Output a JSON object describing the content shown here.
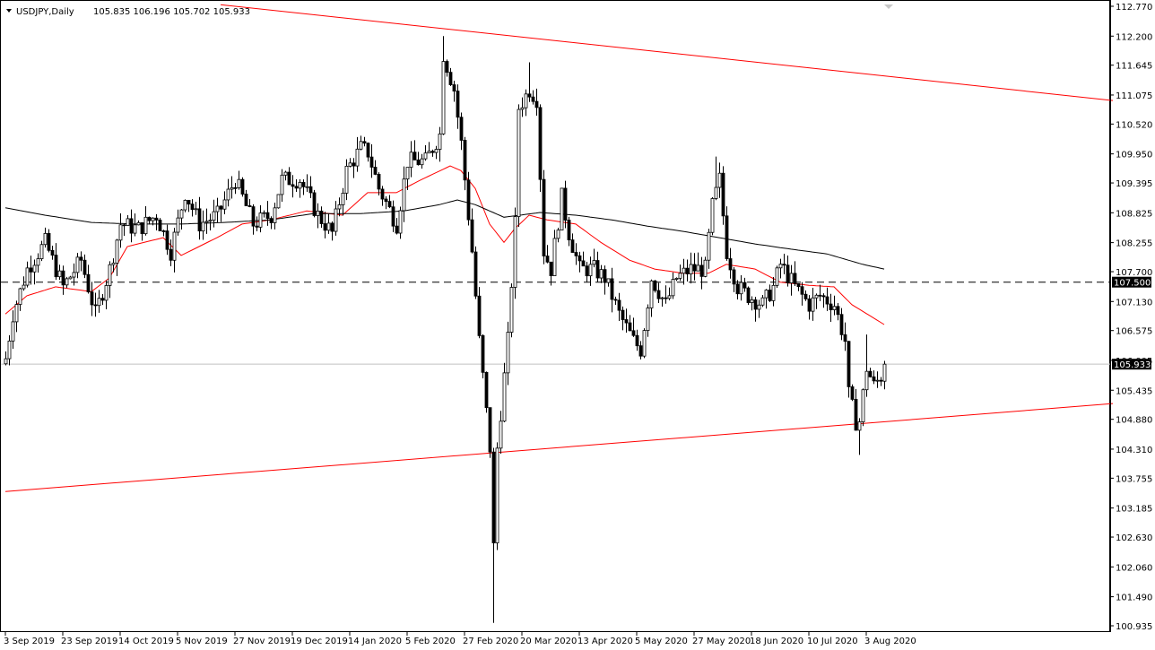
{
  "header": {
    "symbol": "USDJPY,Daily",
    "ohlc": "105.835 106.196 105.702 105.933"
  },
  "colors": {
    "bull_fill": "#ffffff",
    "bear_fill": "#000000",
    "ma_fast": "#ff0000",
    "ma_slow": "#000000",
    "trendline": "#ff0000",
    "level_line": "#000000",
    "price_line": "#c0c0c0"
  },
  "chart_data": {
    "type": "candlestick",
    "title": "USDJPY,Daily",
    "ylim": [
      100.935,
      112.77
    ],
    "y_ticks": [
      "112.770",
      "112.200",
      "111.645",
      "111.075",
      "110.520",
      "109.950",
      "109.395",
      "108.825",
      "108.255",
      "107.700",
      "107.130",
      "106.575",
      "106.005",
      "105.435",
      "104.880",
      "104.310",
      "103.755",
      "103.185",
      "102.630",
      "102.060",
      "101.490",
      "100.935"
    ],
    "x_ticks": [
      {
        "bar": 0,
        "label": "3 Sep 2019"
      },
      {
        "bar": 16,
        "label": "23 Sep 2019"
      },
      {
        "bar": 32,
        "label": "14 Oct 2019"
      },
      {
        "bar": 48,
        "label": "5 Nov 2019"
      },
      {
        "bar": 64,
        "label": "27 Nov 2019"
      },
      {
        "bar": 80,
        "label": "19 Dec 2019"
      },
      {
        "bar": 96,
        "label": "14 Jan 2020"
      },
      {
        "bar": 112,
        "label": "5 Feb 2020"
      },
      {
        "bar": 128,
        "label": "27 Feb 2020"
      },
      {
        "bar": 144,
        "label": "20 Mar 2020"
      },
      {
        "bar": 160,
        "label": "13 Apr 2020"
      },
      {
        "bar": 176,
        "label": "5 May 2020"
      },
      {
        "bar": 192,
        "label": "27 May 2020"
      },
      {
        "bar": 208,
        "label": "18 Jun 2020"
      },
      {
        "bar": 224,
        "label": "10 Jul 2020"
      },
      {
        "bar": 240,
        "label": "3 Aug 2020"
      }
    ],
    "bar_count": 246,
    "close_keypoints": [
      [
        0,
        106.04
      ],
      [
        2,
        106.89
      ],
      [
        6,
        107.75
      ],
      [
        11,
        108.26
      ],
      [
        16,
        107.41
      ],
      [
        21,
        107.92
      ],
      [
        25,
        106.89
      ],
      [
        29,
        107.75
      ],
      [
        32,
        108.61
      ],
      [
        37,
        108.52
      ],
      [
        42,
        108.78
      ],
      [
        46,
        108.09
      ],
      [
        50,
        109.21
      ],
      [
        54,
        108.61
      ],
      [
        59,
        108.78
      ],
      [
        64,
        109.46
      ],
      [
        69,
        108.61
      ],
      [
        74,
        108.78
      ],
      [
        77,
        109.46
      ],
      [
        82,
        109.46
      ],
      [
        87,
        108.78
      ],
      [
        91,
        108.44
      ],
      [
        95,
        109.63
      ],
      [
        99,
        110.06
      ],
      [
        101,
        109.98
      ],
      [
        104,
        109.29
      ],
      [
        109,
        108.61
      ],
      [
        112,
        109.81
      ],
      [
        117,
        109.81
      ],
      [
        121,
        110.32
      ],
      [
        122,
        111.86
      ],
      [
        125,
        111.18
      ],
      [
        127,
        110.15
      ],
      [
        130,
        108.09
      ],
      [
        132,
        106.38
      ],
      [
        135,
        104.33
      ],
      [
        136,
        102.44
      ],
      [
        137,
        104.33
      ],
      [
        140,
        106.38
      ],
      [
        142,
        108.61
      ],
      [
        143,
        110.83
      ],
      [
        146,
        111.18
      ],
      [
        148,
        111.01
      ],
      [
        150,
        108.09
      ],
      [
        152,
        107.75
      ],
      [
        155,
        109.12
      ],
      [
        157,
        108.44
      ],
      [
        160,
        107.75
      ],
      [
        164,
        107.75
      ],
      [
        167,
        107.58
      ],
      [
        171,
        106.89
      ],
      [
        175,
        106.38
      ],
      [
        177,
        106.21
      ],
      [
        180,
        107.58
      ],
      [
        184,
        107.07
      ],
      [
        187,
        107.58
      ],
      [
        191,
        107.75
      ],
      [
        195,
        107.75
      ],
      [
        197,
        108.95
      ],
      [
        199,
        109.46
      ],
      [
        201,
        108.09
      ],
      [
        204,
        107.41
      ],
      [
        207,
        107.24
      ],
      [
        211,
        107.07
      ],
      [
        214,
        107.41
      ],
      [
        216,
        107.84
      ],
      [
        220,
        107.41
      ],
      [
        224,
        107.07
      ],
      [
        227,
        107.24
      ],
      [
        231,
        107.07
      ],
      [
        234,
        106.38
      ],
      [
        235,
        105.35
      ],
      [
        237,
        104.84
      ],
      [
        238,
        104.84
      ],
      [
        240,
        105.87
      ],
      [
        242,
        105.52
      ],
      [
        244,
        105.7
      ],
      [
        245,
        105.933
      ]
    ],
    "wick_extremes": [
      {
        "bar": 122,
        "high": 112.2
      },
      {
        "bar": 136,
        "low": 100.99
      },
      {
        "bar": 146,
        "high": 111.7
      },
      {
        "bar": 198,
        "high": 109.9
      },
      {
        "bar": 238,
        "low": 104.2
      },
      {
        "bar": 240,
        "high": 106.5
      }
    ],
    "series": [
      {
        "name": "MA fast (red)",
        "keypoints": [
          [
            0,
            106.89
          ],
          [
            6,
            107.24
          ],
          [
            14,
            107.41
          ],
          [
            24,
            107.32
          ],
          [
            29,
            107.58
          ],
          [
            34,
            108.18
          ],
          [
            44,
            108.35
          ],
          [
            49,
            108.01
          ],
          [
            59,
            108.35
          ],
          [
            66,
            108.61
          ],
          [
            74,
            108.69
          ],
          [
            84,
            108.86
          ],
          [
            94,
            108.78
          ],
          [
            101,
            109.21
          ],
          [
            109,
            109.21
          ],
          [
            116,
            109.46
          ],
          [
            124,
            109.72
          ],
          [
            127,
            109.63
          ],
          [
            131,
            109.29
          ],
          [
            135,
            108.61
          ],
          [
            139,
            108.26
          ],
          [
            142,
            108.52
          ],
          [
            146,
            108.78
          ],
          [
            151,
            108.69
          ],
          [
            159,
            108.61
          ],
          [
            166,
            108.26
          ],
          [
            174,
            107.92
          ],
          [
            181,
            107.75
          ],
          [
            189,
            107.67
          ],
          [
            196,
            107.67
          ],
          [
            201,
            107.84
          ],
          [
            209,
            107.75
          ],
          [
            216,
            107.5
          ],
          [
            224,
            107.44
          ],
          [
            231,
            107.41
          ],
          [
            236,
            107.07
          ],
          [
            245,
            106.69
          ]
        ]
      },
      {
        "name": "MA slow (black)",
        "keypoints": [
          [
            0,
            108.92
          ],
          [
            11,
            108.78
          ],
          [
            24,
            108.64
          ],
          [
            36,
            108.61
          ],
          [
            49,
            108.61
          ],
          [
            61,
            108.64
          ],
          [
            74,
            108.69
          ],
          [
            86,
            108.81
          ],
          [
            99,
            108.81
          ],
          [
            111,
            108.86
          ],
          [
            121,
            108.98
          ],
          [
            126,
            109.07
          ],
          [
            131,
            108.98
          ],
          [
            139,
            108.74
          ],
          [
            149,
            108.83
          ],
          [
            159,
            108.78
          ],
          [
            169,
            108.69
          ],
          [
            179,
            108.57
          ],
          [
            189,
            108.47
          ],
          [
            199,
            108.35
          ],
          [
            209,
            108.23
          ],
          [
            219,
            108.13
          ],
          [
            229,
            108.04
          ],
          [
            239,
            107.84
          ],
          [
            245,
            107.75
          ]
        ]
      }
    ],
    "trendlines": [
      {
        "name": "upper",
        "points": [
          [
            60,
            112.8
          ],
          [
            308.75,
            110.97
          ]
        ]
      },
      {
        "name": "lower",
        "points": [
          [
            0,
            103.5
          ],
          [
            308.75,
            105.18
          ]
        ]
      }
    ],
    "level_line": {
      "price": 107.5,
      "label": "107.500"
    },
    "current_price": {
      "price": 105.933,
      "label": "105.933"
    }
  }
}
